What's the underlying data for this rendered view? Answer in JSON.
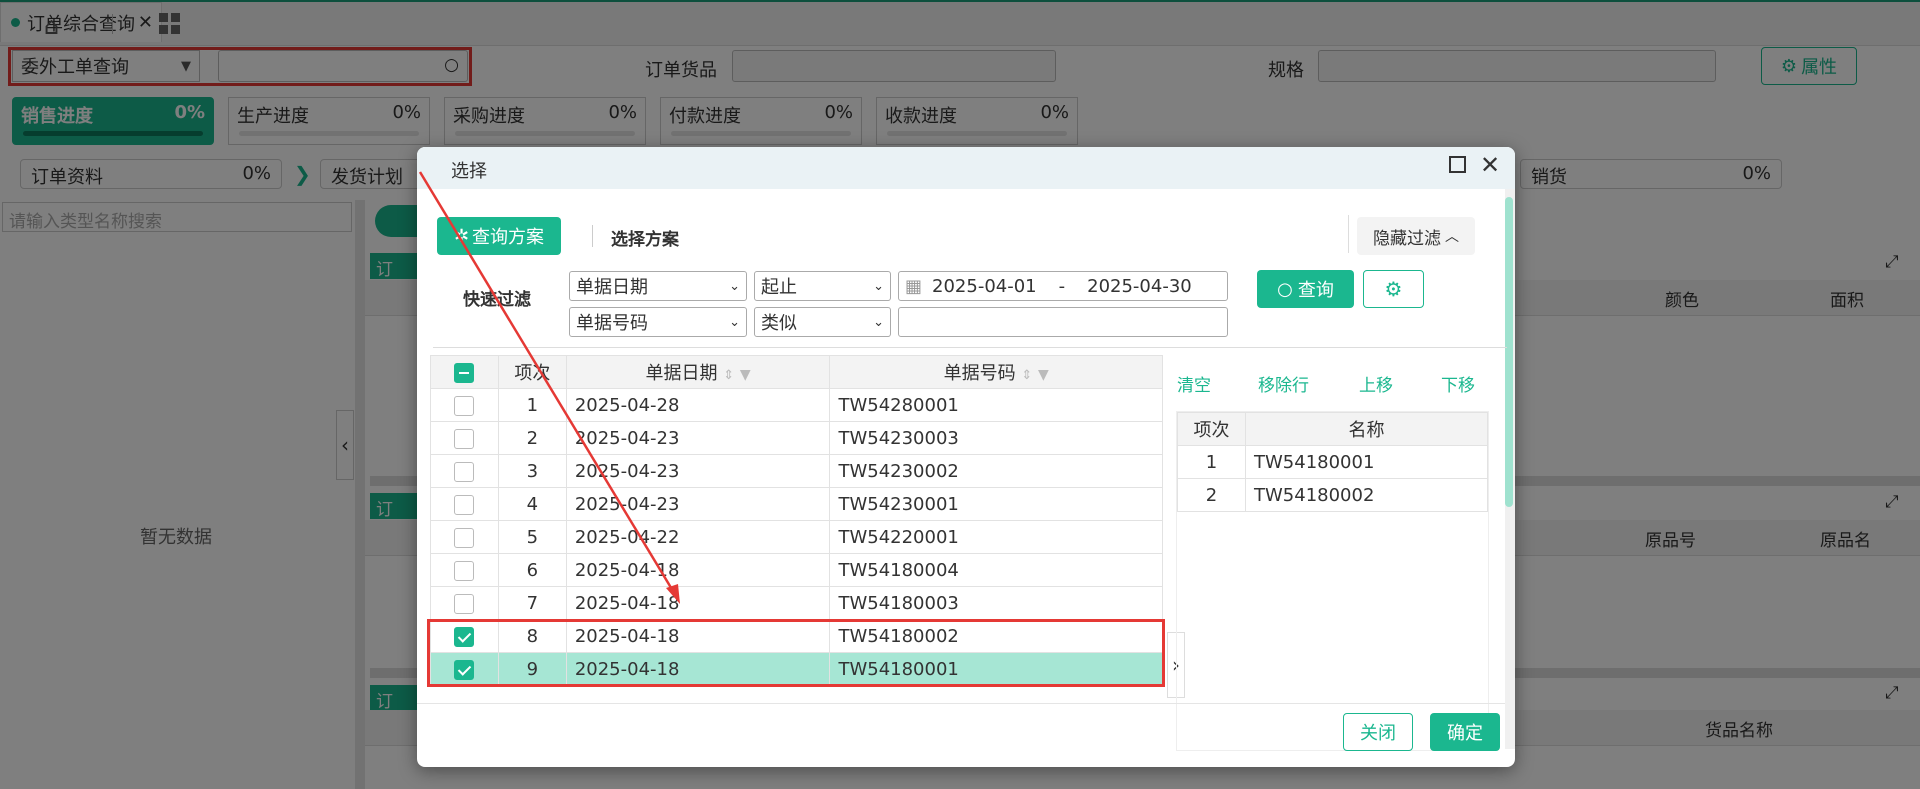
{
  "tabs": {
    "home_icon": "home-icon",
    "apps_icon": "grid-icon",
    "active_tab": "订单综合查询"
  },
  "toolbar": {
    "query_type": "委外工单查询",
    "search_value": "",
    "order_goods_label": "订单货品",
    "spec_label": "规格",
    "property_button": "属性"
  },
  "progress": [
    {
      "label": "销售进度",
      "value": "0%",
      "active": true
    },
    {
      "label": "生产进度",
      "value": "0%"
    },
    {
      "label": "采购进度",
      "value": "0%"
    },
    {
      "label": "付款进度",
      "value": "0%"
    },
    {
      "label": "收款进度",
      "value": "0%"
    }
  ],
  "steps": {
    "order_data": "订单资料",
    "order_data_value": "0%",
    "ship_plan": "发货计划",
    "sales": "销货",
    "sales_value": "0%"
  },
  "left_panel": {
    "search_placeholder": "请输入类型名称搜索",
    "empty_text": "暂无数据"
  },
  "background_columns": {
    "c1": "颜色",
    "c2": "面积",
    "c3": "原品号",
    "c4": "原品名",
    "c5": "货品名称",
    "tag": "订"
  },
  "dialog": {
    "title": "选择",
    "query_plan_btn": "查询方案",
    "select_plan": "选择方案",
    "hide_filter": "隐藏过滤",
    "quick_filter": "快速过滤",
    "filter1_field": "单据日期",
    "filter1_op": "起止",
    "date_from": "2025-04-01",
    "date_sep": "-",
    "date_to": "2025-04-30",
    "filter2_field": "单据号码",
    "filter2_op": "类似",
    "filter2_value": "",
    "query_btn": "查询",
    "grid_headers": {
      "index": "项次",
      "date": "单据日期",
      "number": "单据号码"
    },
    "rows": [
      {
        "idx": "1",
        "date": "2025-04-28",
        "num": "TW54280001",
        "checked": false
      },
      {
        "idx": "2",
        "date": "2025-04-23",
        "num": "TW54230003",
        "checked": false
      },
      {
        "idx": "3",
        "date": "2025-04-23",
        "num": "TW54230002",
        "checked": false
      },
      {
        "idx": "4",
        "date": "2025-04-23",
        "num": "TW54230001",
        "checked": false
      },
      {
        "idx": "5",
        "date": "2025-04-22",
        "num": "TW54220001",
        "checked": false
      },
      {
        "idx": "6",
        "date": "2025-04-18",
        "num": "TW54180004",
        "checked": false
      },
      {
        "idx": "7",
        "date": "2025-04-18",
        "num": "TW54180003",
        "checked": false
      },
      {
        "idx": "8",
        "date": "2025-04-18",
        "num": "TW54180002",
        "checked": true
      },
      {
        "idx": "9",
        "date": "2025-04-18",
        "num": "TW54180001",
        "checked": true,
        "highlight": true
      }
    ],
    "actions": {
      "clear": "清空",
      "remove_row": "移除行",
      "move_up": "上移",
      "move_down": "下移"
    },
    "selected_headers": {
      "index": "项次",
      "name": "名称"
    },
    "selected": [
      {
        "idx": "1",
        "name": "TW54180001"
      },
      {
        "idx": "2",
        "name": "TW54180002"
      }
    ],
    "close_btn": "关闭",
    "ok_btn": "确定"
  },
  "colors": {
    "accent": "#1bb78f",
    "highlight_row": "#a6e6d4",
    "annotation_red": "#e53935"
  }
}
